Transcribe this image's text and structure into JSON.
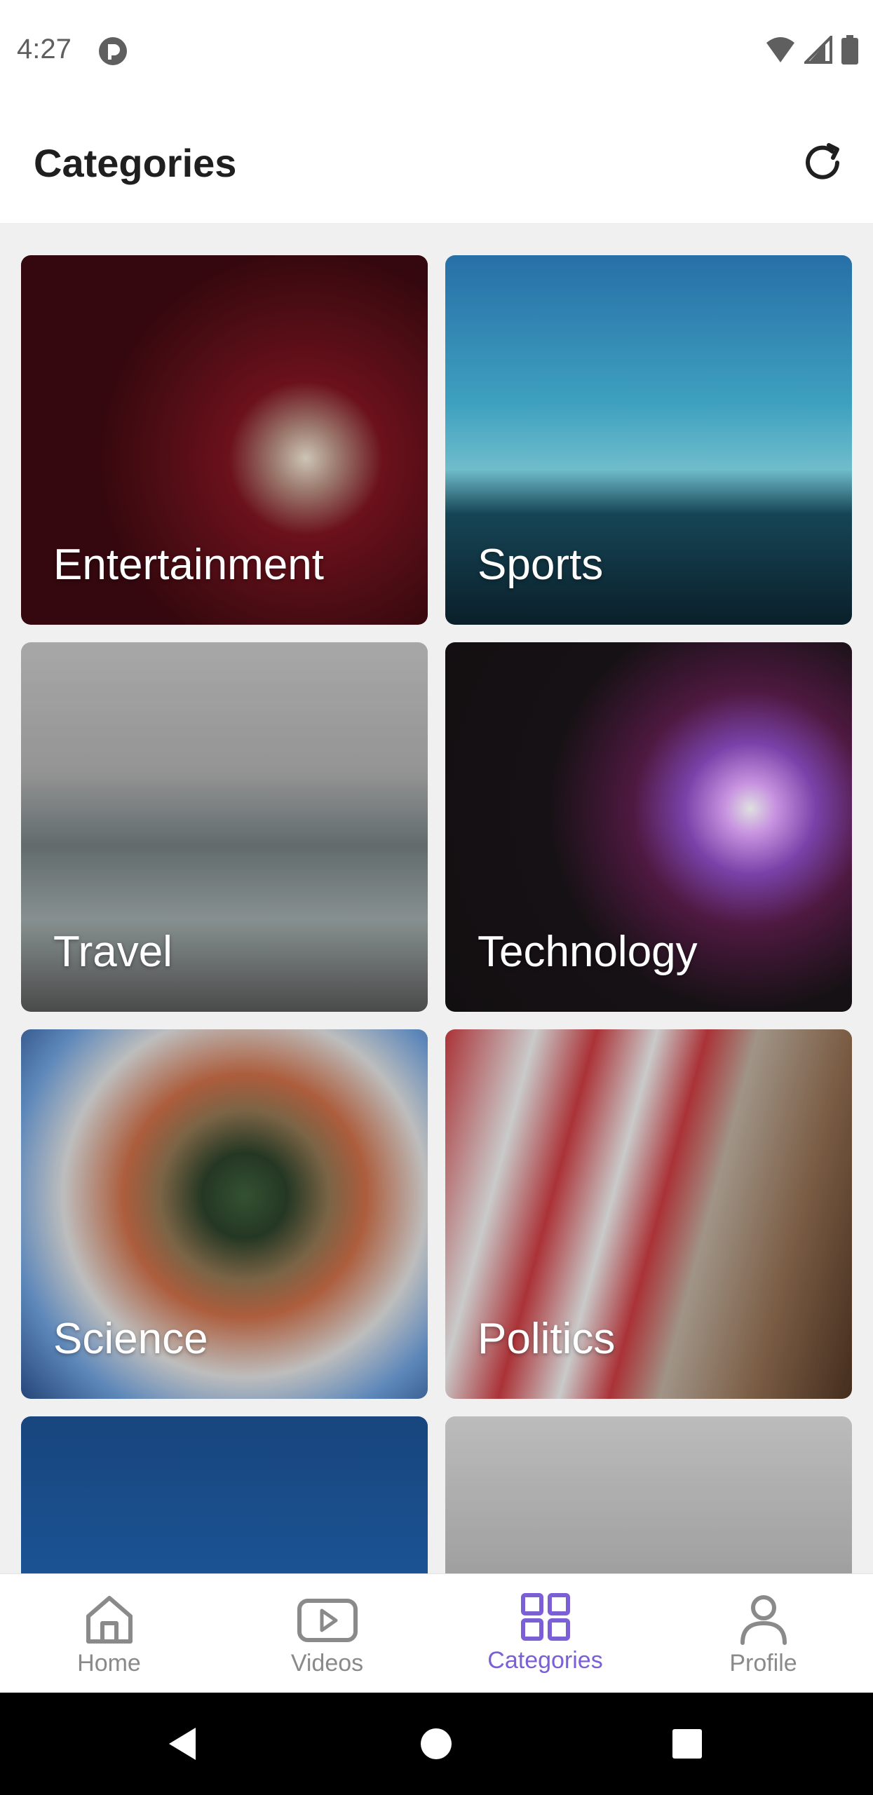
{
  "status_bar": {
    "time": "4:27",
    "app_icon": "pocket-icon",
    "icons": [
      "wifi-icon",
      "signal-icon",
      "battery-icon"
    ]
  },
  "app_bar": {
    "title": "Categories",
    "action_icon": "refresh-icon"
  },
  "categories": [
    {
      "label": "Entertainment",
      "image": "projector-image"
    },
    {
      "label": "Sports",
      "image": "runners-image"
    },
    {
      "label": "Travel",
      "image": "hiker-lake-image"
    },
    {
      "label": "Technology",
      "image": "plasma-ball-image"
    },
    {
      "label": "Science",
      "image": "ferrofluid-image"
    },
    {
      "label": "Politics",
      "image": "us-flag-image"
    },
    {
      "label": "",
      "image": "blue-sky-image"
    },
    {
      "label": "",
      "image": "woman-stretching-image"
    }
  ],
  "bottom_nav": {
    "items": [
      {
        "label": "Home",
        "icon": "home-icon",
        "active": false
      },
      {
        "label": "Videos",
        "icon": "video-icon",
        "active": false
      },
      {
        "label": "Categories",
        "icon": "grid-icon",
        "active": true
      },
      {
        "label": "Profile",
        "icon": "profile-icon",
        "active": false
      }
    ]
  },
  "colors": {
    "accent": "#7b5fd6",
    "inactive": "#8a8a8a",
    "title_text": "#1f1f1f"
  },
  "system_nav": [
    "back-icon",
    "home-circle-icon",
    "recents-icon"
  ]
}
